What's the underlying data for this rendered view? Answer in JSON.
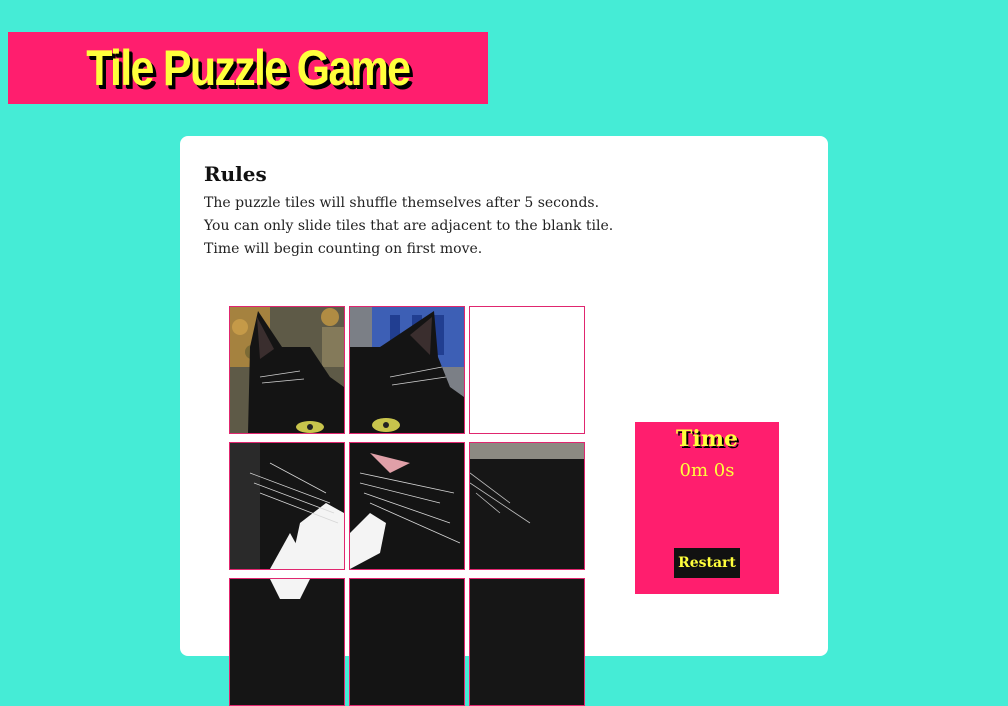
{
  "header": {
    "title": "Tile Puzzle Game"
  },
  "rules": {
    "heading": "Rules",
    "lines": [
      "The puzzle tiles will shuffle themselves after 5 seconds.",
      "You can only slide tiles that are adjacent to the blank tile.",
      "Time will begin counting on first move."
    ]
  },
  "board": {
    "tiles": [
      {
        "piece": "cat-top-left",
        "blank": false
      },
      {
        "piece": "cat-top-middle",
        "blank": false
      },
      {
        "piece": "blank",
        "blank": true
      },
      {
        "piece": "cat-middle-left",
        "blank": false
      },
      {
        "piece": "cat-center",
        "blank": false
      },
      {
        "piece": "cat-middle-right",
        "blank": false
      },
      {
        "piece": "cat-bottom-left",
        "blank": false
      },
      {
        "piece": "cat-bottom-middle",
        "blank": false
      },
      {
        "piece": "cat-bottom-right",
        "blank": false
      }
    ]
  },
  "timer": {
    "label": "Time",
    "value": "0m 0s"
  },
  "controls": {
    "restart_label": "Restart"
  },
  "colors": {
    "background": "#45ecd6",
    "accent": "#ff1e6e",
    "highlight": "#ffff3c"
  }
}
